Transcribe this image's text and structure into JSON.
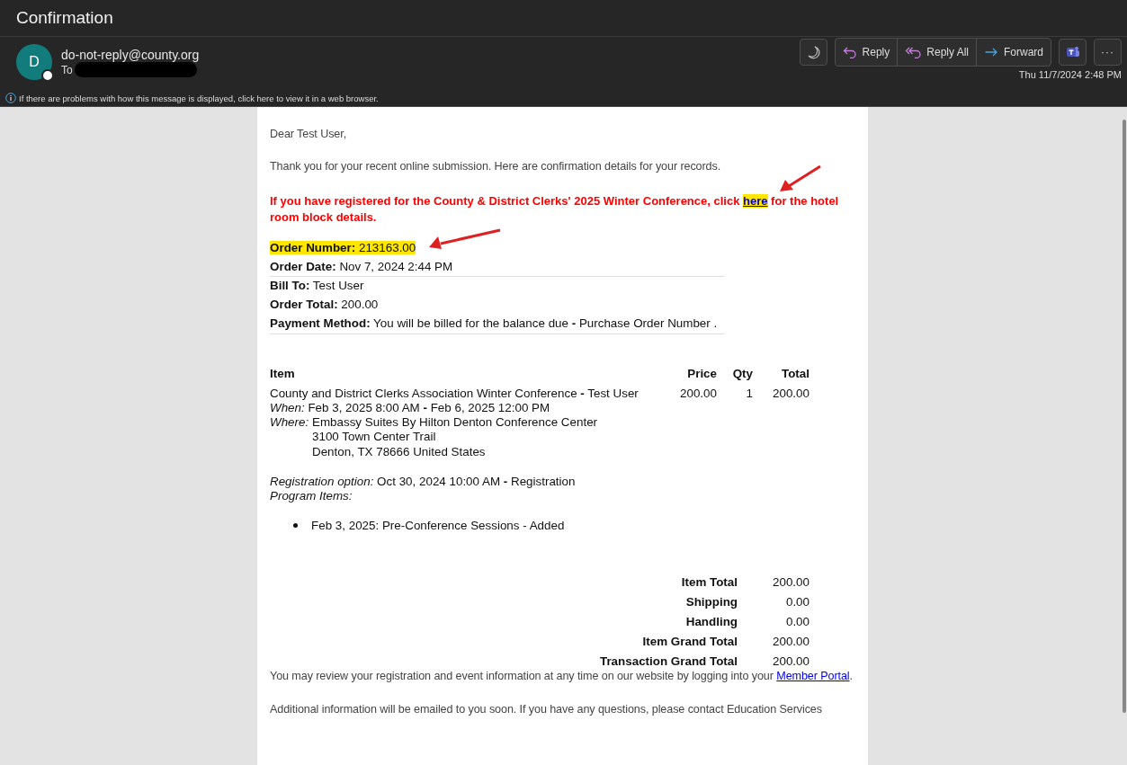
{
  "window": {
    "title": "Confirmation"
  },
  "sender": {
    "avatar_letter": "D",
    "address": "do-not-reply@county.org",
    "to_label": "To",
    "to_redacted": true,
    "presence_on": false
  },
  "info_bar": "If there are problems with how this message is displayed, click here to view it in a web browser.",
  "actions": [
    {
      "kind": "theme"
    },
    {
      "kind": "group",
      "buttons": [
        {
          "label": "Reply"
        },
        {
          "label": "Reply All"
        },
        {
          "label": "Forward"
        }
      ]
    },
    {
      "kind": "app"
    },
    {
      "kind": "more",
      "label": "···"
    }
  ],
  "date": "Thu 11/7/2024 2:48 PM",
  "message": {
    "greeting": "Dear  Test User,",
    "intro": "Thank you for your recent online submission. Here are confirmation details for your records.",
    "notice": {
      "before": "If you have registered for the County & District Clerks' 2025 Winter Conference, click ",
      "link": "here",
      "after": " for the hotel room block details."
    },
    "details": [
      {
        "text": "**Order Number:** 213163.00",
        "highlighted": true,
        "rule_below": false
      },
      {
        "text": "**Order Date:** Nov 7, 2024 2:44 PM",
        "highlighted": false,
        "rule_below": true
      },
      {
        "text": "**Bill To:** Test User",
        "highlighted": false,
        "rule_below": false
      },
      {
        "text": "**Order Total:** 200.00",
        "highlighted": false,
        "rule_below": false
      },
      {
        "text": "**Payment Method:** You will be billed for the balance due **-** Purchase Order Number .",
        "highlighted": false,
        "rule_below": true
      }
    ],
    "table": {
      "columns": [
        "Item",
        "Price",
        "Qty",
        "Total"
      ],
      "rows": [
        {
          "item": "County and District Clerks Association Winter Conference **-** Test User",
          "price": "200.00",
          "qty": "1",
          "total": "200.00",
          "when": "*When:* Feb 3, 2025 8:00 AM **-** Feb 6, 2025 12:00 PM",
          "where_label": "Where:",
          "where_lines": [
            "Embassy Suites By Hilton Denton Conference Center",
            "3100 Town Center Trail",
            "Denton, TX 78666 United States"
          ],
          "registration_option": "*Registration option:* Oct 30, 2024 10:00 AM **-** Registration",
          "program_items_label": "Program Items:",
          "program_items": [
            "Feb 3, 2025: Pre-Conference Sessions - Added"
          ]
        }
      ]
    },
    "totals": [
      {
        "label": "Item Total",
        "value": "200.00"
      },
      {
        "label": "Shipping",
        "value": "0.00"
      },
      {
        "label": "Handling",
        "value": "0.00"
      },
      {
        "label": "Item Grand Total",
        "value": "200.00"
      },
      {
        "label": "Transaction Grand Total",
        "value": "200.00"
      }
    ],
    "review": {
      "before": "You may review your registration and event information at any time on our website by logging into your ",
      "link": "Member Portal",
      "after": "."
    },
    "additional": "Additional information will be emailed to you soon.  If you have any questions, please contact Education Services"
  }
}
